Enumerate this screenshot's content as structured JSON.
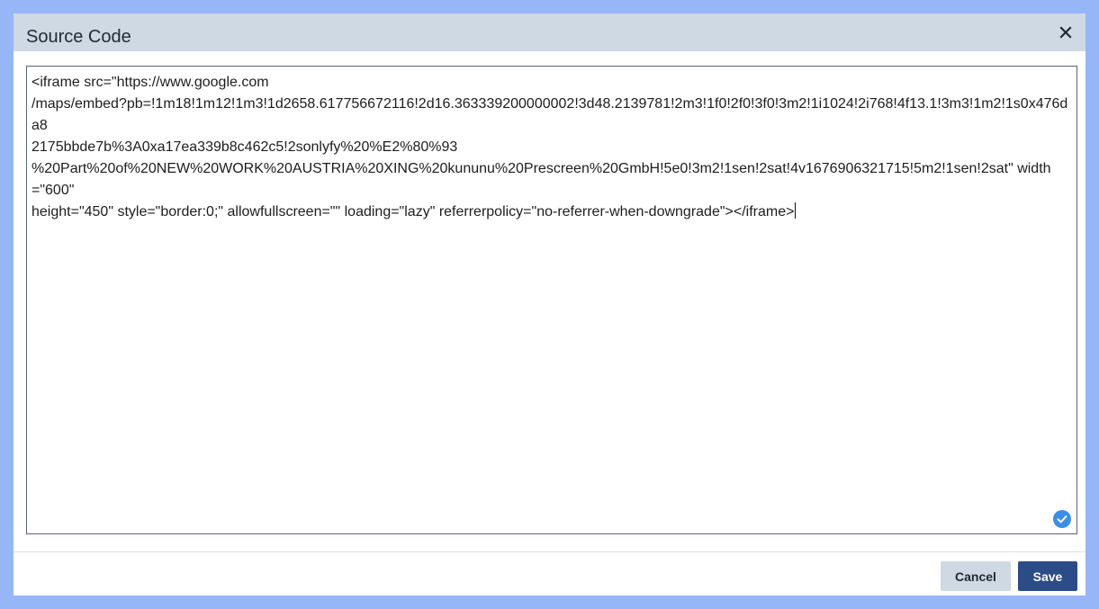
{
  "dialog": {
    "title": "Source Code",
    "close_icon": "close-icon",
    "code": "<iframe src=\"https://www.google.com/maps/embed?pb=!1m18!1m12!1m3!1d2658.617756672116!2d16.363339200000002!3d48.2139781!2m3!1f0!2f0!3f0!3m2!1i1024!2i768!4f13.1!3m3!1m2!1s0x476da82175bbde7b%3A0xa17ea339b8c462c5!2sonlyfy%20%E2%80%93%20Part%20of%20NEW%20WORK%20AUSTRIA%20XING%20kununu%20Prescreen%20GmbH!5e0!3m2!1sen!2sat!4v1676906321715!5m2!1sen!2sat\" width=\"600\" height=\"450\" style=\"border:0;\" allowfullscreen=\"\" loading=\"lazy\" referrerpolicy=\"no-referrer-when-downgrade\"></iframe>",
    "code_lines": [
      "<iframe src=\"https://www.google.com",
      "/maps/embed?pb=!1m18!1m12!1m3!1d2658.617756672116!2d16.363339200000002!3d48.2139781!2m3!1f0!2f0!3f0!3m2!1i1024!2i768!4f13.1!3m3!1m2!1s0x476da8",
      "2175bbde7b%3A0xa17ea339b8c462c5!2sonlyfy%20%E2%80%93",
      "%20Part%20of%20NEW%20WORK%20AUSTRIA%20XING%20kununu%20Prescreen%20GmbH!5e0!3m2!1sen!2sat!4v1676906321715!5m2!1sen!2sat\" width=\"600\"",
      "height=\"450\" style=\"border:0;\" allowfullscreen=\"\" loading=\"lazy\" referrerpolicy=\"no-referrer-when-downgrade\"></iframe>"
    ],
    "status_icon": "check-circle-icon",
    "cancel_label": "Cancel",
    "save_label": "Save"
  },
  "colors": {
    "backdrop": "#97b6f8",
    "header": "#ced9e3",
    "primary": "#2c4c87",
    "check": "#3b8ee8"
  }
}
